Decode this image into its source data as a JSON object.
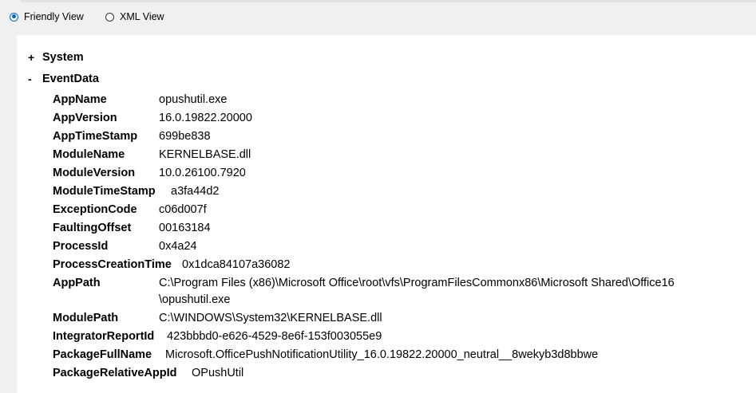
{
  "view_selector": {
    "friendly_label": "Friendly View",
    "xml_label": "XML View",
    "selected": "friendly"
  },
  "tree": {
    "system": {
      "toggle": "+",
      "label": "System"
    },
    "eventdata": {
      "toggle": "-",
      "label": "EventData"
    }
  },
  "fields": [
    {
      "key": "AppName",
      "value": "opushutil.exe"
    },
    {
      "key": "AppVersion",
      "value": "16.0.19822.20000"
    },
    {
      "key": "AppTimeStamp",
      "value": "699be838"
    },
    {
      "key": "ModuleName",
      "value": "KERNELBASE.dll"
    },
    {
      "key": "ModuleVersion",
      "value": "10.0.26100.7920"
    },
    {
      "key": "ModuleTimeStamp",
      "value": "a3fa44d2"
    },
    {
      "key": "ExceptionCode",
      "value": "c06d007f"
    },
    {
      "key": "FaultingOffset",
      "value": "00163184"
    },
    {
      "key": "ProcessId",
      "value": "0x4a24"
    },
    {
      "key": "ProcessCreationTime",
      "value": "0x1dca84107a36082"
    },
    {
      "key": "AppPath",
      "value": "C:\\Program Files (x86)\\Microsoft Office\\root\\vfs\\ProgramFilesCommonx86\\Microsoft Shared\\Office16",
      "value2": "\\opushutil.exe"
    },
    {
      "key": "ModulePath",
      "value": "C:\\WINDOWS\\System32\\KERNELBASE.dll"
    },
    {
      "key": "IntegratorReportId",
      "value": "423bbbd0-e626-4529-8e6f-153f003055e9"
    },
    {
      "key": "PackageFullName",
      "value": "Microsoft.OfficePushNotificationUtility_16.0.19822.20000_neutral__8wekyb3d8bbwe"
    },
    {
      "key": "PackageRelativeAppId",
      "value": "OPushUtil"
    }
  ]
}
